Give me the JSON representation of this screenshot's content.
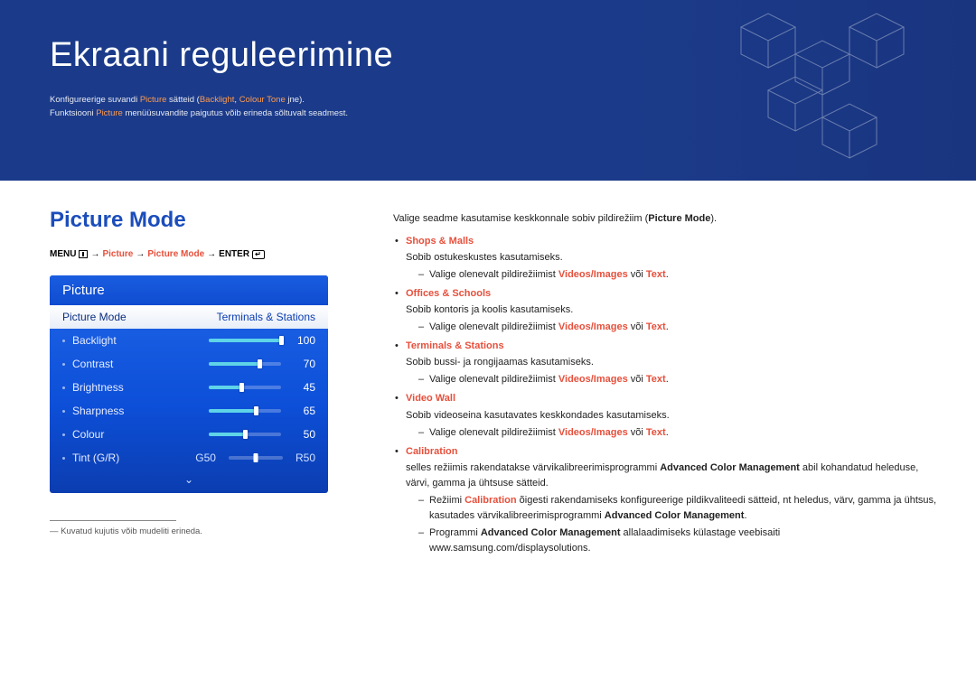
{
  "banner": {
    "title": "Ekraani reguleerimine",
    "intro_pre": "Konfigureerige suvandi ",
    "intro_hl1": "Picture",
    "intro_mid": " sätteid (",
    "intro_hl2": "Backlight",
    "intro_sep": ", ",
    "intro_hl3": "Colour Tone",
    "intro_post": " jne).",
    "intro2_pre": "Funktsiooni ",
    "intro2_hl": "Picture",
    "intro2_post": " menüüsuvandite paigutus võib erineda sõltuvalt seadmest."
  },
  "section": {
    "title": "Picture Mode"
  },
  "menupath": {
    "menu": "MENU",
    "p1": "Picture",
    "p2": "Picture Mode",
    "enter": "ENTER"
  },
  "osd": {
    "header": "Picture",
    "sel_label": "Picture Mode",
    "sel_value": "Terminals & Stations",
    "rows": [
      {
        "label": "Backlight",
        "value": 100,
        "pct": 100
      },
      {
        "label": "Contrast",
        "value": 70,
        "pct": 70
      },
      {
        "label": "Brightness",
        "value": 45,
        "pct": 45
      },
      {
        "label": "Sharpness",
        "value": 65,
        "pct": 65
      },
      {
        "label": "Colour",
        "value": 50,
        "pct": 50
      }
    ],
    "tint": {
      "label": "Tint (G/R)",
      "g": "G50",
      "r": "R50"
    }
  },
  "footnote": "― Kuvatud kujutis võib mudeliti erineda.",
  "right": {
    "lead_pre": "Valige seadme kasutamise keskkonnale sobiv pildirežiim (",
    "lead_b": "Picture Mode",
    "lead_post": ").",
    "modes": [
      {
        "name": "Shops & Malls",
        "desc": "Sobib ostukeskustes kasutamiseks.",
        "sub": [
          {
            "pre": "Valige olenevalt pildirežiimist ",
            "hl1": "Videos/Images",
            "mid": " või ",
            "hl2": "Text",
            "post": "."
          }
        ]
      },
      {
        "name": "Offices & Schools",
        "desc": "Sobib kontoris ja koolis kasutamiseks.",
        "sub": [
          {
            "pre": "Valige olenevalt pildirežiimist ",
            "hl1": "Videos/Images",
            "mid": " või ",
            "hl2": "Text",
            "post": "."
          }
        ]
      },
      {
        "name": "Terminals & Stations",
        "desc": "Sobib bussi- ja rongijaamas kasutamiseks.",
        "sub": [
          {
            "pre": "Valige olenevalt pildirežiimist ",
            "hl1": "Videos/Images",
            "mid": " või ",
            "hl2": "Text",
            "post": "."
          }
        ]
      },
      {
        "name": "Video Wall",
        "desc": "Sobib videoseina kasutavates keskkondades kasutamiseks.",
        "sub": [
          {
            "pre": "Valige olenevalt pildirežiimist ",
            "hl1": "Videos/Images",
            "mid": " või ",
            "hl2": "Text",
            "post": "."
          }
        ]
      }
    ],
    "calib": {
      "name": "Calibration",
      "desc_pre": "selles režiimis rakendatakse värvikalibreerimisprogrammi ",
      "desc_b": "Advanced Color Management",
      "desc_post": " abil kohandatud heleduse, värvi, gamma ja ühtsuse sätteid.",
      "sub": [
        {
          "pre": "Režiimi ",
          "hl": "Calibration",
          "mid": " õigesti rakendamiseks konfigureerige pildikvaliteedi sätteid, nt heledus, värv, gamma ja ühtsus, kasutades värvikalibreerimisprogrammi ",
          "b": "Advanced Color Management",
          "post": "."
        },
        {
          "pre": "Programmi ",
          "b": "Advanced Color Management",
          "post": " allalaadimiseks külastage veebisaiti www.samsung.com/displaysolutions."
        }
      ]
    }
  }
}
